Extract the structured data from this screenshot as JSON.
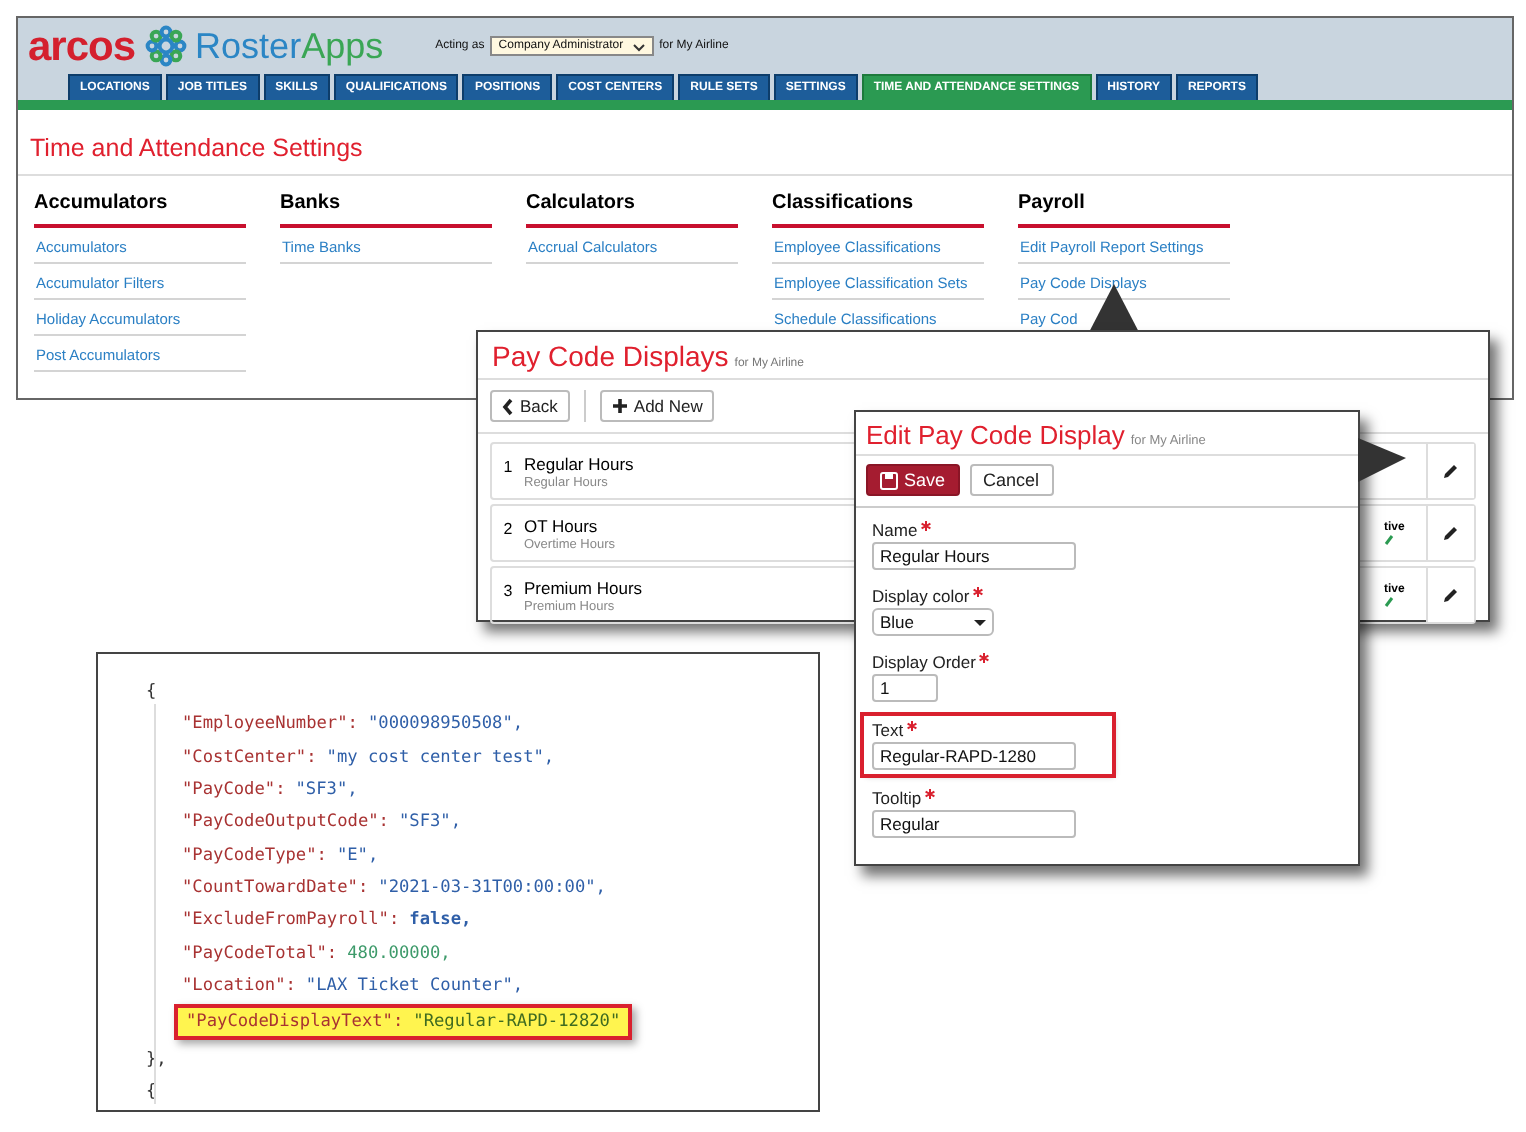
{
  "main_window": {
    "logo": {
      "brand": "arcos",
      "product_prefix": "Roster",
      "product_suffix": "Apps"
    },
    "acting_as": {
      "label": "Acting as",
      "role": "Company Administrator",
      "suffix": "for My Airline"
    },
    "nav_tabs": [
      {
        "label": "LOCATIONS",
        "selected": false
      },
      {
        "label": "JOB TITLES",
        "selected": false
      },
      {
        "label": "SKILLS",
        "selected": false
      },
      {
        "label": "QUALIFICATIONS",
        "selected": false
      },
      {
        "label": "POSITIONS",
        "selected": false
      },
      {
        "label": "COST CENTERS",
        "selected": false
      },
      {
        "label": "RULE SETS",
        "selected": false
      },
      {
        "label": "SETTINGS",
        "selected": false
      },
      {
        "label": "TIME AND ATTENDANCE SETTINGS",
        "selected": true
      },
      {
        "label": "HISTORY",
        "selected": false
      },
      {
        "label": "REPORTS",
        "selected": false
      }
    ],
    "page_title": "Time and Attendance Settings",
    "sections": [
      {
        "heading": "Accumulators",
        "links": [
          "Accumulators",
          "Accumulator Filters",
          "Holiday Accumulators",
          "Post Accumulators"
        ]
      },
      {
        "heading": "Banks",
        "links": [
          "Time Banks"
        ]
      },
      {
        "heading": "Calculators",
        "links": [
          "Accrual Calculators"
        ]
      },
      {
        "heading": "Classifications",
        "links": [
          "Employee Classifications",
          "Employee Classification Sets",
          "Schedule Classifications"
        ]
      },
      {
        "heading": "Payroll",
        "links": [
          "Edit Payroll Report Settings",
          "Pay Code Displays",
          "Pay Cod"
        ]
      }
    ]
  },
  "pay_code_displays": {
    "title": "Pay Code Displays",
    "subtitle": "for My Airline",
    "back_button": "Back",
    "add_button": "Add New",
    "rows": [
      {
        "number": "1",
        "name": "Regular Hours",
        "description": "Regular Hours"
      },
      {
        "number": "2",
        "name": "OT Hours",
        "description": "Overtime Hours",
        "status": "tive"
      },
      {
        "number": "3",
        "name": "Premium Hours",
        "description": "Premium Hours",
        "status": "tive"
      }
    ]
  },
  "edit_dialog": {
    "title": "Edit Pay Code Display",
    "subtitle": "for My Airline",
    "save_button": "Save",
    "cancel_button": "Cancel",
    "fields": [
      {
        "label": "Name",
        "required": true,
        "kind": "text",
        "value": "Regular Hours",
        "highlighted": false
      },
      {
        "label": "Display color",
        "required": true,
        "kind": "select",
        "value": "Blue",
        "highlighted": false
      },
      {
        "label": "Display Order",
        "required": true,
        "kind": "number",
        "value": "1",
        "highlighted": false
      },
      {
        "label": "Text",
        "required": true,
        "kind": "text",
        "value": "Regular-RAPD-1280",
        "highlighted": true
      },
      {
        "label": "Tooltip",
        "required": true,
        "kind": "text",
        "value": "Regular",
        "highlighted": false
      }
    ]
  },
  "code": {
    "lines": [
      {
        "kind": "brace",
        "text": "{"
      },
      {
        "kind": "string",
        "key": "\"EmployeeNumber\":",
        "value": "\"000098950508\",",
        "highlighted": false
      },
      {
        "kind": "string",
        "key": "\"CostCenter\":",
        "value": "\"my cost center test\",",
        "highlighted": false
      },
      {
        "kind": "string",
        "key": "\"PayCode\":",
        "value": "\"SF3\",",
        "highlighted": false
      },
      {
        "kind": "string",
        "key": "\"PayCodeOutputCode\":",
        "value": "\"SF3\",",
        "highlighted": false
      },
      {
        "kind": "string",
        "key": "\"PayCodeType\":",
        "value": "\"E\",",
        "highlighted": false
      },
      {
        "kind": "string",
        "key": "\"CountTowardDate\":",
        "value": "\"2021-03-31T00:00:00\",",
        "highlighted": false
      },
      {
        "kind": "boolean",
        "key": "\"ExcludeFromPayroll\":",
        "value": "false,",
        "highlighted": false
      },
      {
        "kind": "number",
        "key": "\"PayCodeTotal\":",
        "value": "480.00000,",
        "highlighted": false
      },
      {
        "kind": "string",
        "key": "\"Location\":",
        "value": "\"LAX Ticket Counter\",",
        "highlighted": false
      },
      {
        "kind": "string",
        "key": "\"PayCodeDisplayText\":",
        "value": "\"Regular-RAPD-12820\"",
        "highlighted": true
      },
      {
        "kind": "brace",
        "text": "},"
      },
      {
        "kind": "brace",
        "text": "{"
      }
    ]
  }
}
